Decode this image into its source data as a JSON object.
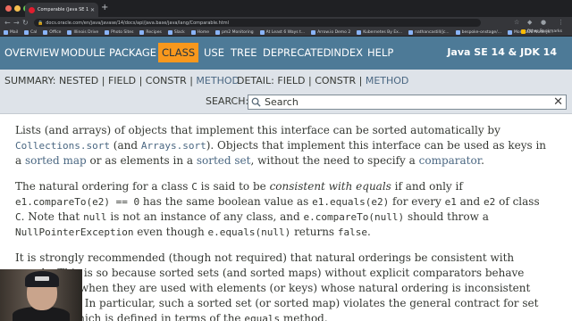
{
  "browser": {
    "tab_title": "Comparable (Java SE 14 & JD...",
    "url": "docs.oracle.com/en/java/javase/14/docs/api/java.base/java/lang/Comparable.html",
    "bookmarks": [
      "Mail",
      "Cal",
      "Office",
      "Illinois Drive",
      "Photo Sites",
      "Recipes",
      "Slack",
      "Home",
      "pm2 Monitoring",
      "At Least 6 Ways t...",
      "Arrow.io Demo 2",
      "Kubernetes By Ex...",
      "nathancastill/jc...",
      "bespoke-onstage/...",
      "MongoDB Node.js..."
    ],
    "other_bookmarks": "Other Bookmarks"
  },
  "topnav": {
    "items": [
      "OVERVIEW",
      "MODULE",
      "PACKAGE",
      "CLASS",
      "USE",
      "TREE",
      "DEPRECATED",
      "INDEX",
      "HELP"
    ],
    "about": "Java SE 14 & JDK 14"
  },
  "subnav": {
    "summary_label": "SUMMARY:",
    "summary_nested": "NESTED",
    "summary_field": "FIELD",
    "summary_constr": "CONSTR",
    "summary_method": "METHOD",
    "detail_label": "DETAIL:",
    "detail_field": "FIELD",
    "detail_constr": "CONSTR",
    "detail_method": "METHOD",
    "sep": " | ",
    "search_label": "SEARCH:",
    "search_placeholder": "Search"
  },
  "content": {
    "p1": {
      "t1": "Lists (and arrays) of objects that implement this interface can be sorted automatically by ",
      "c1": "Collections.sort",
      "t2": " (and ",
      "c2": "Arrays.sort",
      "t3": "). Objects that implement this interface can be used as keys in a ",
      "l1": "sorted map",
      "t4": " or as elements in a ",
      "l2": "sorted set",
      "t5": ", without the need to specify a ",
      "l3": "comparator",
      "t6": "."
    },
    "p2": {
      "t1": "The natural ordering for a class ",
      "c1": "C",
      "t2": " is said to be ",
      "em": "consistent with equals",
      "t3": " if and only if ",
      "c2": "e1.compareTo(e2) == 0",
      "t4": " has the same boolean value as ",
      "c3": "e1.equals(e2)",
      "t5": " for every ",
      "c4": "e1",
      "t6": " and ",
      "c5": "e2",
      "t7": " of class ",
      "c6": "C",
      "t8": ". Note that ",
      "c7": "null",
      "t9": " is not an instance of any class, and ",
      "c8": "e.compareTo(null)",
      "t10": " should throw a ",
      "c9": "NullPointerException",
      "t11": " even though ",
      "c10": "e.equals(null)",
      "t12": " returns ",
      "c11": "false",
      "t13": "."
    },
    "p3": {
      "t1": "It is strongly recommended (though not required) that natural orderings be consistent with equals. This is so because sorted sets (and sorted maps) without explicit comparators behave \"strangely\" when they are used with elements (or keys) whose natural ordering is inconsistent with equals. In particular, such a sorted set (or sorted map) violates the general contract for set (or map), which is defined in terms of the ",
      "c1": "equals",
      "t2": " method."
    }
  }
}
